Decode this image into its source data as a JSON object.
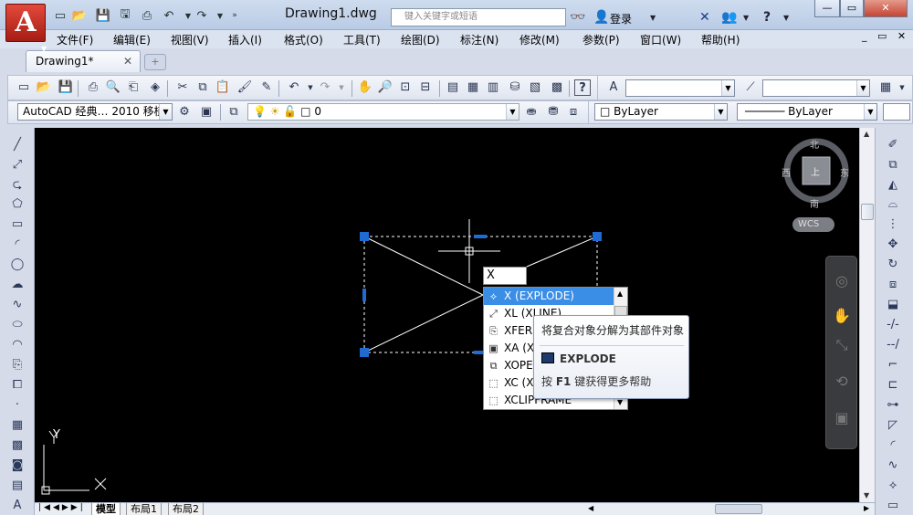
{
  "app": {
    "logo_letter": "A",
    "document_title": "Drawing1.dwg",
    "search_placeholder": "键入关键字或短语",
    "login_label": "登录",
    "win_buttons": [
      "—",
      "▭",
      "✕"
    ]
  },
  "menu": [
    "文件(F)",
    "编辑(E)",
    "视图(V)",
    "插入(I)",
    "格式(O)",
    "工具(T)",
    "绘图(D)",
    "标注(N)",
    "修改(M)",
    "参数(P)",
    "窗口(W)",
    "帮助(H)"
  ],
  "mdi_buttons": "_ ▭ ✕",
  "tabs": {
    "document_tab": "Drawing1*",
    "close": "✕"
  },
  "toolbar": {
    "workspace_value": "AutoCAD 经典… 2010 移植",
    "layer_value": "0",
    "color_value": "ByLayer",
    "linetype_value": "ByLayer"
  },
  "command": {
    "input_value": "X"
  },
  "autocomplete": [
    {
      "icon": "explode-icon",
      "label": "X (EXPLODE)",
      "selected": true
    },
    {
      "icon": "xline-icon",
      "label": "XL (XLINE)",
      "selected": false
    },
    {
      "icon": "xfer-icon",
      "label": "XFER",
      "selected": false
    },
    {
      "icon": "xattach-icon",
      "label": "XA (X",
      "selected": false
    },
    {
      "icon": "xopen-icon",
      "label": "XOPE",
      "selected": false
    },
    {
      "icon": "xclip-icon",
      "label": "XC (X",
      "selected": false
    },
    {
      "icon": "xclipframe-icon",
      "label": "XCLIPFRAME",
      "selected": false
    }
  ],
  "tooltip": {
    "description": "将复合对象分解为其部件对象",
    "command": "EXPLODE",
    "help_prefix": "按 ",
    "help_key": "F1",
    "help_suffix": " 键获得更多帮助"
  },
  "viewcube": {
    "north": "北",
    "south": "南",
    "east": "东",
    "west": "西",
    "top_face": "上",
    "wcs": "WCS"
  },
  "ucs": {
    "x_label": "X",
    "y_label": "Y"
  },
  "layout_tabs": [
    "模型",
    "布局1",
    "布局2"
  ]
}
